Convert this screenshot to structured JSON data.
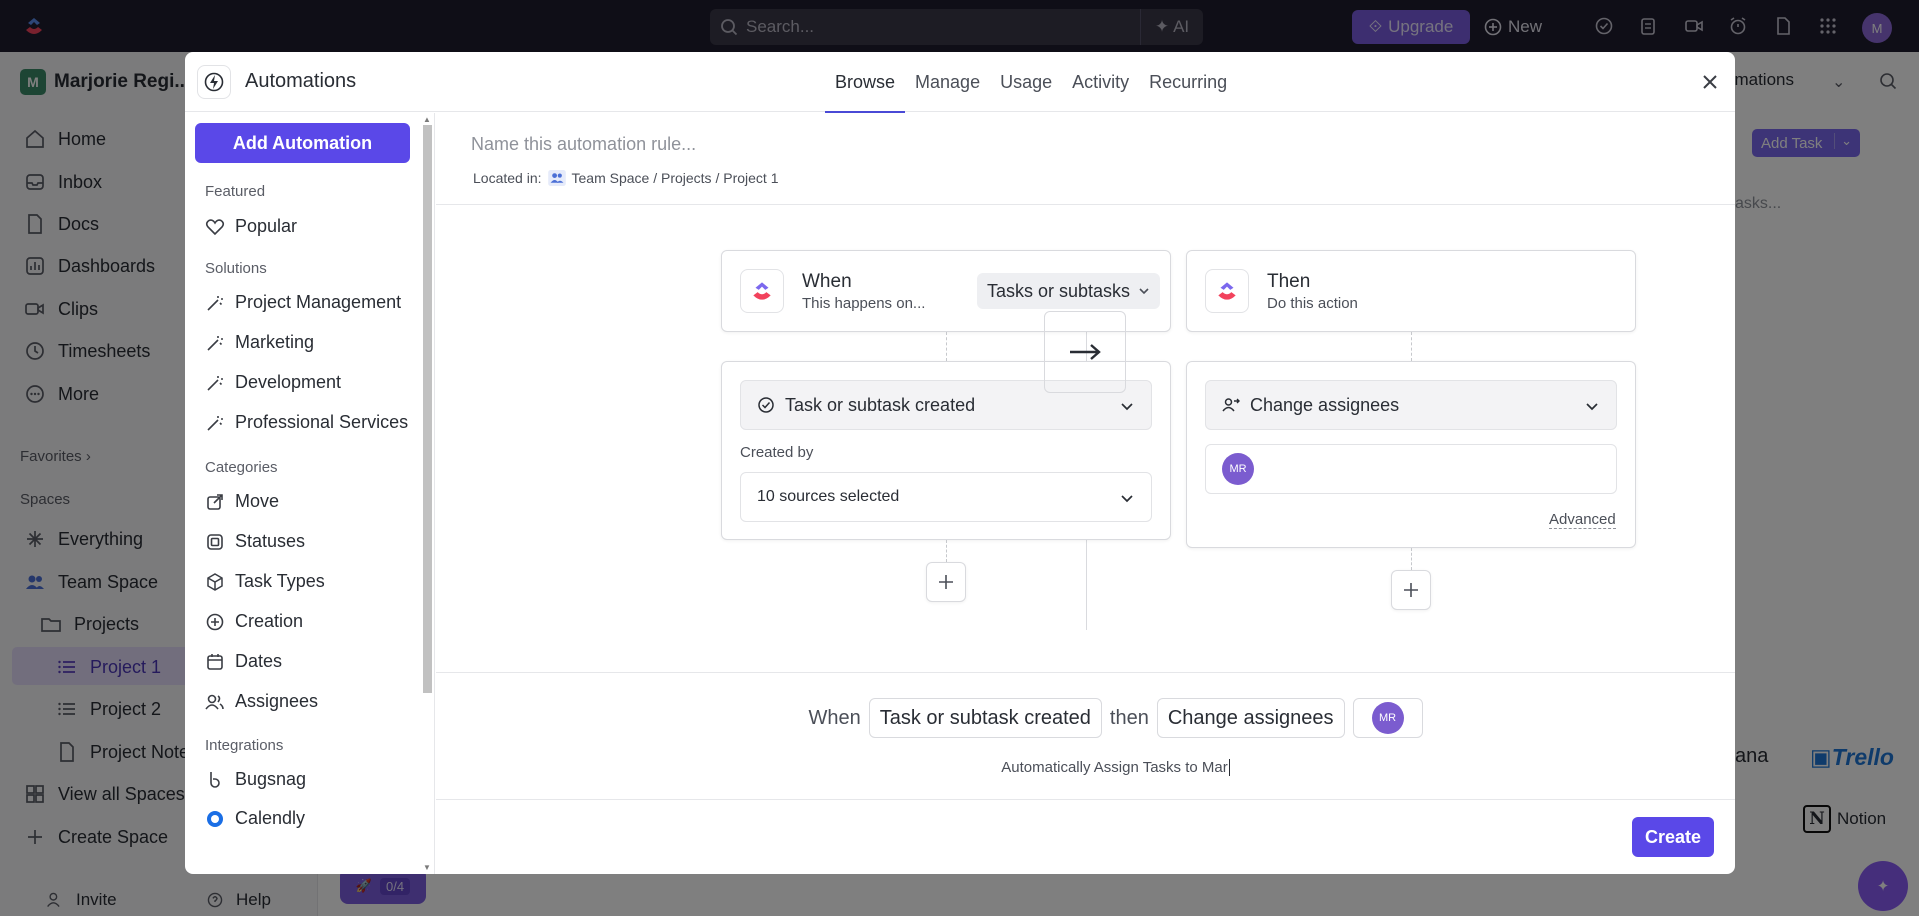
{
  "topbar": {
    "search_placeholder": "Search...",
    "ai_label": "AI",
    "upgrade_label": "Upgrade",
    "new_label": "New",
    "avatar_initial": "M"
  },
  "sidebar": {
    "workspace_initial": "M",
    "workspace_name": "Marjorie Regi...",
    "nav": [
      {
        "label": "Home",
        "icon": "home-icon"
      },
      {
        "label": "Inbox",
        "icon": "inbox-icon"
      },
      {
        "label": "Docs",
        "icon": "docs-icon"
      },
      {
        "label": "Dashboards",
        "icon": "dashboards-icon"
      },
      {
        "label": "Clips",
        "icon": "clips-icon"
      },
      {
        "label": "Timesheets",
        "icon": "timesheets-icon"
      },
      {
        "label": "More",
        "icon": "more-icon"
      }
    ],
    "favorites_label": "Favorites",
    "spaces_label": "Spaces",
    "spaces": [
      {
        "label": "Everything"
      },
      {
        "label": "Team Space"
      },
      {
        "label": "Projects"
      },
      {
        "label": "Project 1"
      },
      {
        "label": "Project 2"
      },
      {
        "label": "Project Note"
      },
      {
        "label": "View all Spaces"
      },
      {
        "label": "Create Space"
      }
    ],
    "invite_label": "Invite",
    "help_label": "Help"
  },
  "background": {
    "automations_tab": "omations",
    "add_task": "Add Task",
    "search_tasks": "asks...",
    "asana_fragment": "ana",
    "trello_label": "Trello",
    "notion_label": "Notion",
    "rocket_count": "0/4"
  },
  "modal": {
    "title": "Automations",
    "tabs": [
      {
        "label": "Browse"
      },
      {
        "label": "Manage"
      },
      {
        "label": "Usage"
      },
      {
        "label": "Activity"
      },
      {
        "label": "Recurring"
      }
    ],
    "left": {
      "add_automation": "Add Automation",
      "featured_label": "Featured",
      "featured": [
        {
          "label": "Popular"
        }
      ],
      "solutions_label": "Solutions",
      "solutions": [
        {
          "label": "Project Management"
        },
        {
          "label": "Marketing"
        },
        {
          "label": "Development"
        },
        {
          "label": "Professional Services"
        }
      ],
      "categories_label": "Categories",
      "categories": [
        {
          "label": "Move"
        },
        {
          "label": "Statuses"
        },
        {
          "label": "Task Types"
        },
        {
          "label": "Creation"
        },
        {
          "label": "Dates"
        },
        {
          "label": "Assignees"
        }
      ],
      "integrations_label": "Integrations",
      "integrations": [
        {
          "label": "Bugsnag"
        },
        {
          "label": "Calendly"
        }
      ]
    },
    "editor": {
      "name_placeholder": "Name this automation rule...",
      "located_prefix": "Located in:",
      "located_path": "Team Space / Projects / Project 1",
      "when": {
        "title": "When",
        "subtitle": "This happens on...",
        "scope": "Tasks or subtasks",
        "trigger": "Task or subtask created",
        "created_by_label": "Created by",
        "sources": "10 sources selected"
      },
      "then": {
        "title": "Then",
        "subtitle": "Do this action",
        "action": "Change assignees",
        "assignee_initials": "MR",
        "advanced_label": "Advanced"
      },
      "summary": {
        "when_word": "When",
        "trigger_chip": "Task or subtask created",
        "then_word": "then",
        "action_chip": "Change assignees",
        "avatar_initials": "MR"
      },
      "automation_name": "Automatically Assign Tasks to Mar",
      "create_label": "Create"
    }
  }
}
